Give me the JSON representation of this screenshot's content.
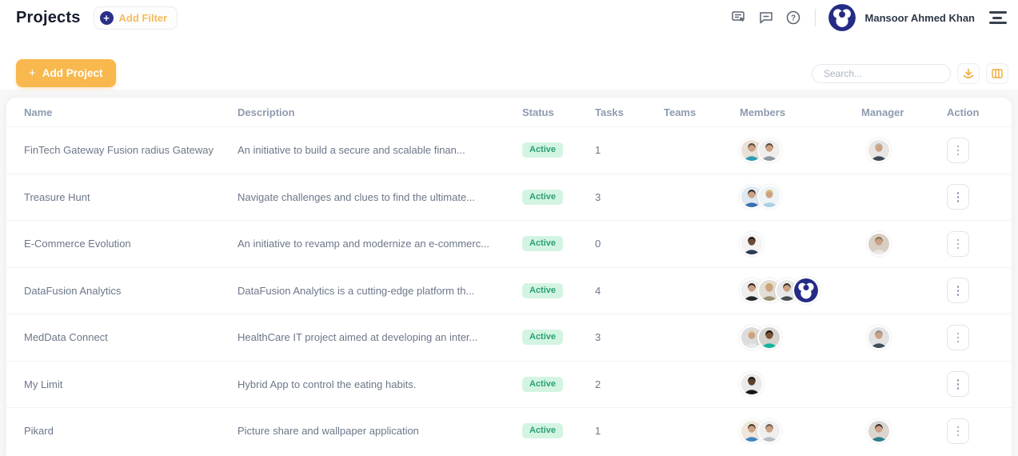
{
  "header": {
    "title": "Projects",
    "add_filter_label": "Add Filter",
    "add_filter_plus": "+",
    "user_name": "Mansoor Ahmed Khan",
    "icons": [
      "guide-icon",
      "chat-icon",
      "help-icon"
    ]
  },
  "toolbar": {
    "add_project_label": "Add Project",
    "add_project_plus": "+",
    "search_placeholder": "Search..."
  },
  "colors": {
    "accent_orange": "#f8b84d",
    "brand_navy": "#252c85",
    "badge_bg": "#d4f4e2",
    "badge_text": "#27a275"
  },
  "table": {
    "columns": [
      "Name",
      "Description",
      "Status",
      "Tasks",
      "Teams",
      "Members",
      "Manager",
      "Action"
    ],
    "rows": [
      {
        "name": "FinTech Gateway Fusion radius Gateway",
        "description": "An initiative to build a secure and scalable finan...",
        "status": "Active",
        "tasks": "1",
        "teams": "",
        "members": [
          {
            "kind": "person",
            "bg": "#e9e2d8",
            "shirt": "#2f9bb3"
          },
          {
            "kind": "person",
            "bg": "#f0eeec",
            "shirt": "#8e979e"
          }
        ],
        "manager": [
          {
            "kind": "person",
            "bg": "#e8e6e3",
            "shirt": "#3c4856",
            "hair": "#b9b6ae"
          }
        ]
      },
      {
        "name": "Treasure Hunt",
        "description": "Navigate challenges and clues to find the ultimate...",
        "status": "Active",
        "tasks": "3",
        "teams": "",
        "members": [
          {
            "kind": "person",
            "bg": "#dfe9f2",
            "shirt": "#3a6fae",
            "hair": "#2e2620"
          },
          {
            "kind": "person",
            "bg": "#eef3f6",
            "shirt": "#a8cfe4",
            "hair": "#d9c27a"
          }
        ],
        "manager": []
      },
      {
        "name": "E-Commerce Evolution",
        "description": "An initiative to revamp and modernize an e-commerc...",
        "status": "Active",
        "tasks": "0",
        "teams": "",
        "members": [
          {
            "kind": "person",
            "bg": "#f3f3f3",
            "shirt": "#2c3a57",
            "skin": "#6e4a33",
            "hair": "#1f1713"
          }
        ],
        "manager": [
          {
            "kind": "person",
            "bg": "#d8cfc4",
            "shirt": "#e9e7e2",
            "hair": "#8a6f52"
          }
        ]
      },
      {
        "name": "DataFusion Analytics",
        "description": "DataFusion Analytics is a cutting-edge platform th...",
        "status": "Active",
        "tasks": "4",
        "teams": "",
        "members": [
          {
            "kind": "person",
            "bg": "#efefef",
            "shirt": "#23272b",
            "hair": "#2a211b"
          },
          {
            "kind": "person",
            "bg": "#e2ddd5",
            "shirt": "#9b8f72",
            "hair": "#caa85c"
          },
          {
            "kind": "person",
            "bg": "#e9e9e9",
            "shirt": "#4a4f55",
            "hair": "#3b2f26"
          },
          {
            "kind": "logo"
          }
        ],
        "manager": []
      },
      {
        "name": "MedData Connect",
        "description": "HealthCare IT project aimed at developing an inter...",
        "status": "Active",
        "tasks": "3",
        "teams": "",
        "members": [
          {
            "kind": "person",
            "bg": "#dcdcdc",
            "shirt": "#e8e8e8",
            "hair": "#e3cf9a"
          },
          {
            "kind": "person",
            "bg": "#d6d2cc",
            "shirt": "#12b49a",
            "skin": "#7a5236",
            "hair": "#16100c"
          }
        ],
        "manager": [
          {
            "kind": "person",
            "bg": "#e2e2e2",
            "shirt": "#3f4c59",
            "hair": "#8f8b84"
          }
        ]
      },
      {
        "name": "My Limit",
        "description": "Hybrid App to control the eating habits.",
        "status": "Active",
        "tasks": "2",
        "teams": "",
        "members": [
          {
            "kind": "person",
            "bg": "#e9e9e9",
            "shirt": "#16181a",
            "skin": "#5f4026",
            "hair": "#14100c"
          }
        ],
        "manager": []
      },
      {
        "name": "Pikard",
        "description": "Picture share and wallpaper application",
        "status": "Active",
        "tasks": "1",
        "teams": "",
        "members": [
          {
            "kind": "person",
            "bg": "#efe7dc",
            "shirt": "#3f86c2",
            "hair": "#4a3625"
          },
          {
            "kind": "person",
            "bg": "#efefef",
            "shirt": "#b9bec3",
            "hair": "#6e5a44"
          }
        ],
        "manager": [
          {
            "kind": "person",
            "bg": "#dad5cf",
            "shirt": "#2e7e8a",
            "hair": "#3c2e22"
          }
        ]
      }
    ]
  }
}
